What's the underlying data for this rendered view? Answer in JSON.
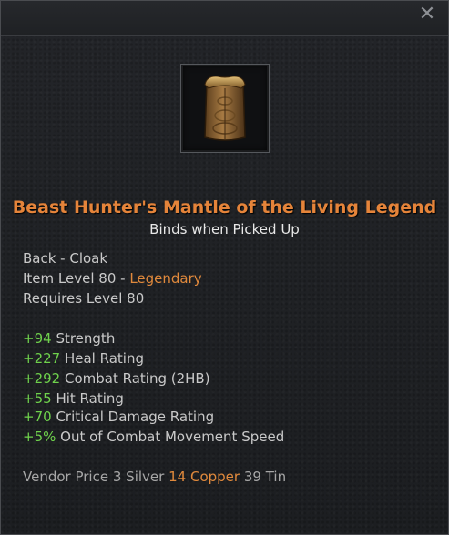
{
  "tooltip": {
    "close_glyph": "✕",
    "item_name": "Beast Hunter's Mantle of the Living Legend",
    "binding": "Binds when Picked Up",
    "slot": "Back - Cloak",
    "item_level_label": "Item Level 80 - ",
    "rarity": "Legendary",
    "requires": "Requires Level 80",
    "stats": [
      {
        "value": "+94",
        "name": "Strength"
      },
      {
        "value": "+227",
        "name": "Heal Rating"
      },
      {
        "value": "+292",
        "name": "Combat Rating (2HB)"
      },
      {
        "value": "+55",
        "name": "Hit Rating"
      },
      {
        "value": "+70",
        "name": "Critical Damage Rating"
      },
      {
        "value": "+5%",
        "name": "Out of Combat Movement Speed"
      }
    ],
    "vendor": {
      "label": "Vendor Price",
      "silver_amount": "3",
      "silver_label": "Silver",
      "copper_amount": "14",
      "copper_label": "Copper",
      "tin_amount": "39",
      "tin_label": "Tin"
    },
    "icon": "cloak-icon",
    "colors": {
      "legendary": "#e5843a",
      "stat_bonus": "#6fd24c",
      "copper": "#e0893c",
      "background": "#1f2124"
    }
  }
}
